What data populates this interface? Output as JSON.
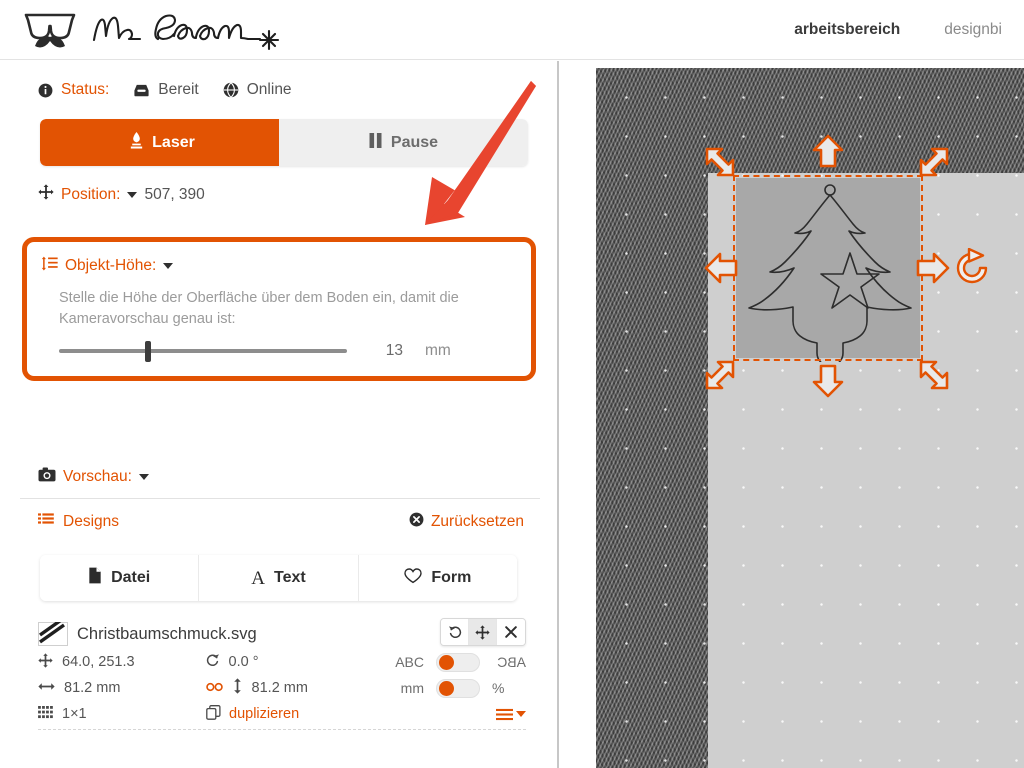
{
  "app": {
    "brand_name": "Mr Beam",
    "logo_icon": "glasses-moustache-logo",
    "wordmark_icon": "mr-beam-wordmark"
  },
  "topnav": {
    "items": [
      {
        "label": "arbeitsbereich",
        "active": true
      },
      {
        "label": "designbi",
        "active": false
      }
    ]
  },
  "status": {
    "info_icon": "info-circle-icon",
    "label": "Status:",
    "machine_icon": "inbox-icon",
    "machine_state": "Bereit",
    "connection_icon": "globe-icon",
    "connection_state": "Online"
  },
  "controls": {
    "laser_icon": "laser-flame-icon",
    "laser_label": "Laser",
    "pause_icon": "pause-icon",
    "pause_label": "Pause"
  },
  "position": {
    "icon": "move-crosshair-icon",
    "label": "Position:",
    "value": "507, 390",
    "caret_icon": "caret-down-icon"
  },
  "object_height": {
    "icon": "height-lines-icon",
    "label": "Objekt-Höhe:",
    "caret_icon": "caret-down-icon",
    "description": "Stelle die Höhe der Oberfläche über dem Boden ein, damit die Kameravorschau genau ist:",
    "slider_value": "13",
    "slider_percent": 31,
    "unit": "mm",
    "highlight_color": "#e25303"
  },
  "preview": {
    "icon": "camera-icon",
    "label": "Vorschau:",
    "caret_icon": "caret-down-icon"
  },
  "designs": {
    "icon": "list-icon",
    "title": "Designs",
    "reset_icon": "close-circle-icon",
    "reset_label": "Zurücksetzen",
    "segments": [
      {
        "icon": "file-icon",
        "label": "Datei"
      },
      {
        "icon": "text-a-icon",
        "label": "Text"
      },
      {
        "icon": "heart-icon",
        "label": "Form"
      }
    ]
  },
  "file_item": {
    "thumb_icon": "svg-thumbnail-icon",
    "name": "Christbaumschmuck.svg",
    "tools": [
      {
        "icon": "rotate-ccw-icon",
        "name": "undo-button",
        "active": false
      },
      {
        "icon": "move-arrows-icon",
        "name": "move-button",
        "active": true
      },
      {
        "icon": "close-x-icon",
        "name": "remove-button",
        "active": false
      }
    ],
    "position_icon": "move-crosshair-icon",
    "position_value": "64.0, 251.3",
    "rotation_icon": "rotate-cw-icon",
    "rotation_value": "0.0 °",
    "width_icon": "arrows-horizontal-icon",
    "width_value": "81.2 mm",
    "link_icon": "link-infinity-icon",
    "height_icon": "arrows-vertical-icon",
    "height_value": "81.2 mm",
    "grid_icon": "grid-icon",
    "grid_value": "1×1",
    "duplicate_icon": "copy-icon",
    "duplicate_label": "duplizieren",
    "menu_icon": "hamburger-menu-icon",
    "toggles": [
      {
        "left_label": "ABC",
        "right_label": "ABC",
        "state": "left",
        "name": "mirror-text-toggle"
      },
      {
        "left_label": "mm",
        "right_label": "%",
        "state": "left",
        "name": "unit-toggle"
      }
    ]
  },
  "canvas": {
    "selection_color": "#e25303",
    "handles": [
      "resize-nw-handle",
      "resize-n-handle",
      "resize-ne-handle",
      "resize-w-handle",
      "resize-e-handle",
      "resize-sw-handle",
      "resize-s-handle",
      "resize-se-handle"
    ],
    "rotate_handle": "rotate-handle",
    "design_icon": "christmas-tree-outline"
  },
  "annotation": {
    "arrow_icon": "red-pointer-arrow",
    "color": "#e8452f"
  }
}
